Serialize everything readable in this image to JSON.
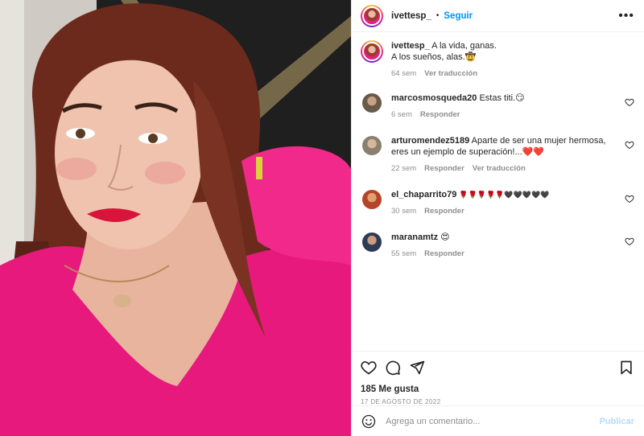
{
  "header": {
    "username": "ivettesp_",
    "separator": "•",
    "follow_label": "Seguir",
    "more_icon": "more-horizontal-icon"
  },
  "caption": {
    "username": "ivettesp_",
    "line1": "A la vida, ganas.",
    "line2": "A los sueños, alas.🤠",
    "time": "64 sem",
    "translate_label": "Ver traducción"
  },
  "comments": [
    {
      "username": "marcosmosqueda20",
      "text": "Estas titi.😏",
      "time": "6 sem",
      "reply_label": "Responder",
      "translate_label": "",
      "avatar_color": "#7a6a5a"
    },
    {
      "username": "arturomendez5189",
      "text": "Aparte de ser una mujer hermosa, eres un ejemplo de superación!...❤️❤️",
      "time": "22 sem",
      "reply_label": "Responder",
      "translate_label": "Ver traducción",
      "avatar_color": "#9a8f7e"
    },
    {
      "username": "el_chaparrito79",
      "text": "🌹🌹🌹🌹🌹🖤🖤🖤🖤🖤",
      "time": "30 sem",
      "reply_label": "Responder",
      "translate_label": "",
      "avatar_color": "#c0502e"
    },
    {
      "username": "maranamtz",
      "text": "😍",
      "time": "55 sem",
      "reply_label": "Responder",
      "translate_label": "",
      "avatar_color": "#3a4a66"
    }
  ],
  "actions": {
    "likes": "185 Me gusta",
    "date": "17 DE AGOSTO DE 2022"
  },
  "add_comment": {
    "placeholder": "Agrega un comentario...",
    "post_label": "Publicar"
  },
  "colors": {
    "accent": "#0095f6",
    "post_disabled": "#b3dbff",
    "muted": "#8e8e8e",
    "text": "#262626",
    "shirt": "#e8197d"
  }
}
